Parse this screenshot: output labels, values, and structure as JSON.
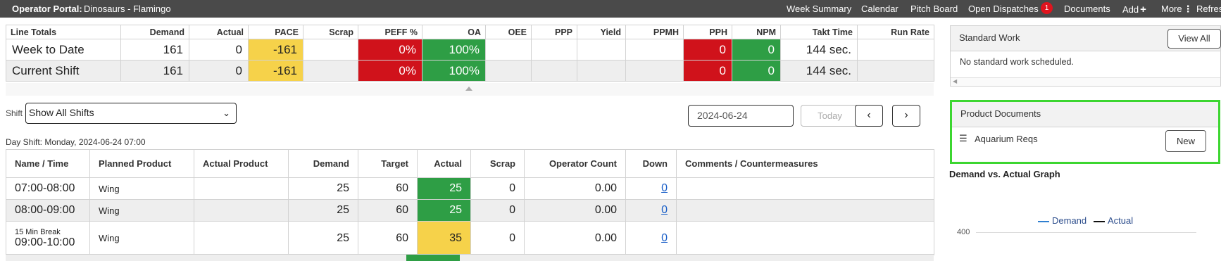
{
  "topbar": {
    "title": "Operator Portal:",
    "subtitle": "Dinosaurs - Flamingo",
    "nav": {
      "week_summary": "Week Summary",
      "calendar": "Calendar",
      "pitch_board": "Pitch Board",
      "open_dispatches": "Open Dispatches",
      "dispatch_count": "1",
      "documents": "Documents",
      "add": "Add",
      "more": "More",
      "refresh": "Refres"
    }
  },
  "totals": {
    "headers": [
      "Line Totals",
      "Demand",
      "Actual",
      "PACE",
      "Scrap",
      "PEFF %",
      "OA",
      "OEE",
      "PPP",
      "Yield",
      "PPMH",
      "PPH",
      "NPM",
      "Takt Time",
      "Run Rate"
    ],
    "rows": [
      {
        "label": "Week to Date",
        "demand": "161",
        "actual": "0",
        "pace": "-161",
        "scrap": "",
        "peff": "0%",
        "oa": "100%",
        "oee": "",
        "ppp": "",
        "yield": "",
        "ppmh": "",
        "pph": "0",
        "npm": "0",
        "takt": "144 sec.",
        "run_rate": ""
      },
      {
        "label": "Current Shift",
        "demand": "161",
        "actual": "0",
        "pace": "-161",
        "scrap": "",
        "peff": "0%",
        "oa": "100%",
        "oee": "",
        "ppp": "",
        "yield": "",
        "ppmh": "",
        "pph": "0",
        "npm": "0",
        "takt": "144 sec.",
        "run_rate": ""
      }
    ]
  },
  "shift": {
    "label": "Shift",
    "selected": "Show All Shifts",
    "date": "2024-06-24",
    "today_button": "Today",
    "day_shift_label": "Day Shift: Monday, 2024-06-24 07:00"
  },
  "hours": {
    "headers": [
      "Name / Time",
      "Planned Product",
      "Actual Product",
      "Demand",
      "Target",
      "Actual",
      "Scrap",
      "Operator Count",
      "Down",
      "Comments / Countermeasures"
    ],
    "rows": [
      {
        "name": "",
        "time": "07:00-08:00",
        "planned": "Wing",
        "actual_product": "",
        "demand": "25",
        "target": "60",
        "actual": "25",
        "scrap": "0",
        "operator_count": "0.00",
        "down": "0",
        "comments": ""
      },
      {
        "name": "",
        "time": "08:00-09:00",
        "planned": "Wing",
        "actual_product": "",
        "demand": "25",
        "target": "60",
        "actual": "25",
        "scrap": "0",
        "operator_count": "0.00",
        "down": "0",
        "comments": ""
      },
      {
        "name": "15 Min Break",
        "time": "09:00-10:00",
        "planned": "Wing",
        "actual_product": "",
        "demand": "25",
        "target": "60",
        "actual": "35",
        "scrap": "0",
        "operator_count": "0.00",
        "down": "0",
        "comments": ""
      }
    ]
  },
  "standard_work": {
    "title": "Standard Work",
    "view_all": "View All",
    "empty_text": "No standard work scheduled."
  },
  "product_documents": {
    "title": "Product Documents",
    "item": "Aquarium Reqs",
    "new_button": "New"
  },
  "graph": {
    "title": "Demand vs. Actual Graph",
    "legend_demand": "Demand",
    "legend_actual": "Actual",
    "y_tick": "400",
    "demand_color": "#2f7fd0",
    "actual_color": "#111111"
  }
}
